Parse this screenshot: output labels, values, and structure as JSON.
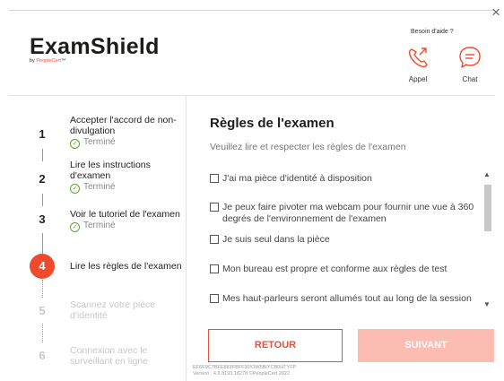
{
  "window": {
    "close_label": "×"
  },
  "brand": {
    "name": "ExamShield",
    "by": "by ",
    "by_brand": "PeopleCert",
    "tm": "™"
  },
  "help": {
    "title": "Besoin d'aide ?",
    "phone_label": "Appel",
    "chat_label": "Chat",
    "accent_color": "#ef4a2d"
  },
  "steps": [
    {
      "number": "1",
      "label": "Accepter l'accord de non-divulgation",
      "status": "Terminé",
      "state": "done"
    },
    {
      "number": "2",
      "label": "Lire les instructions d'examen",
      "status": "Terminé",
      "state": "done"
    },
    {
      "number": "3",
      "label": "Voir le tutoriel de l'examen",
      "status": "Terminé",
      "state": "done"
    },
    {
      "number": "4",
      "label": "Lire les règles de l'examen",
      "status": "",
      "state": "active"
    },
    {
      "number": "5",
      "label": "Scannez votre pièce d'identité",
      "status": "",
      "state": "pending"
    },
    {
      "number": "6",
      "label": "Connexion avec le surveillant en ligne",
      "status": "",
      "state": "pending"
    }
  ],
  "main": {
    "title": "Règles de l'examen",
    "subtitle": "Veuillez lire et respecter les règles de l'examen",
    "rules": [
      {
        "text": "J'ai ma pièce d'identité à disposition",
        "checked": false
      },
      {
        "text": "Je peux faire pivoter ma webcam pour fournir une vue à 360 degrés de l'environnement de l'examen",
        "checked": false
      },
      {
        "text": "Je suis seul dans la pièce",
        "checked": false
      },
      {
        "text": "Mon bureau est propre et conforme aux règles de test",
        "checked": false
      },
      {
        "text": "Mes haut-parleurs seront allumés tout au long de la session",
        "checked": false
      }
    ]
  },
  "buttons": {
    "back": "RETOUR",
    "next": "SUIVANT"
  },
  "footer": {
    "id": "EF6E9C7BFE881FBFF30!OW5BIYCB0HTYFP",
    "version": "Version : 4.6.8193.18278 ©PeopleCert 2022"
  }
}
